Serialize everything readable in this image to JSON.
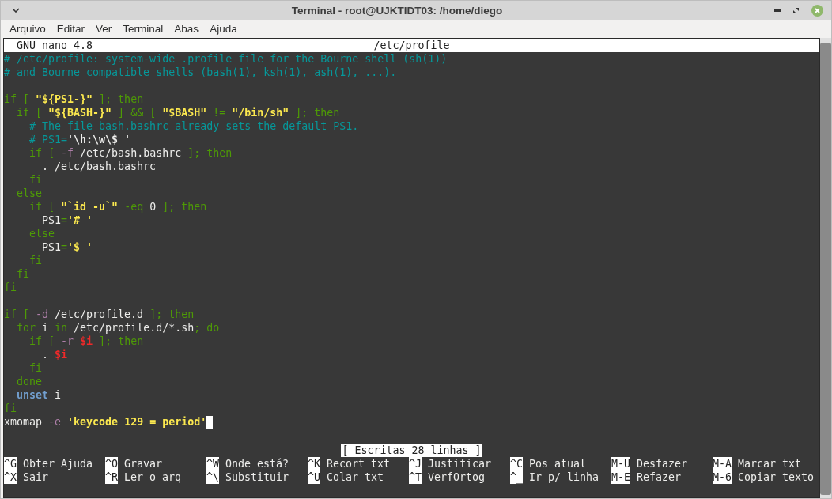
{
  "window": {
    "title": "Terminal - root@UJKTIDT03: /home/diego"
  },
  "menu": [
    "Arquivo",
    "Editar",
    "Ver",
    "Terminal",
    "Abas",
    "Ajuda"
  ],
  "nano": {
    "version": "GNU nano 4.8",
    "filename": "/etc/profile"
  },
  "lines": [
    {
      "cursor": false,
      "segments": [
        {
          "kind": "comment",
          "text": "# /etc/profile: system-wide .profile file for the Bourne shell (sh(1))"
        }
      ]
    },
    {
      "cursor": false,
      "segments": [
        {
          "kind": "comment",
          "text": "# and Bourne compatible shells (bash(1), ksh(1), ash(1), ...)."
        }
      ]
    },
    {
      "cursor": false
    },
    {
      "cursor": false,
      "segments": [
        {
          "kind": "keyword",
          "text": "if [ "
        },
        {
          "kind": "string",
          "text": "\"${PS1-}\""
        },
        {
          "kind": "keyword",
          "text": " ]; then"
        }
      ]
    },
    {
      "cursor": false,
      "segments": [
        {
          "kind": "keyword",
          "text": "  if [ "
        },
        {
          "kind": "string",
          "text": "\"${BASH-}\""
        },
        {
          "kind": "keyword",
          "text": " ] && [ "
        },
        {
          "kind": "string",
          "text": "\"$BASH\""
        },
        {
          "kind": "keyword",
          "text": " != "
        },
        {
          "kind": "string",
          "text": "\"/bin/sh\""
        },
        {
          "kind": "keyword",
          "text": " ]; then"
        }
      ]
    },
    {
      "cursor": false,
      "segments": [
        {
          "kind": "comment",
          "text": "    # The file bash.bashrc already sets the default PS1."
        }
      ]
    },
    {
      "cursor": false,
      "segments": [
        {
          "kind": "comment",
          "text": "    # PS1="
        },
        {
          "kind": "quoted",
          "text": "'\\h:\\w\\$ '"
        }
      ]
    },
    {
      "cursor": false,
      "segments": [
        {
          "kind": "keyword",
          "text": "    if [ "
        },
        {
          "kind": "option",
          "text": "-f"
        },
        {
          "kind": "plain",
          "text": " /etc/bash.bashrc "
        },
        {
          "kind": "keyword",
          "text": "]; then"
        }
      ]
    },
    {
      "cursor": false,
      "segments": [
        {
          "kind": "plain",
          "text": "      . /etc/bash.bashrc"
        }
      ]
    },
    {
      "cursor": false,
      "segments": [
        {
          "kind": "keyword",
          "text": "    fi"
        }
      ]
    },
    {
      "cursor": false,
      "segments": [
        {
          "kind": "keyword",
          "text": "  else"
        }
      ]
    },
    {
      "cursor": false,
      "segments": [
        {
          "kind": "keyword",
          "text": "    if [ "
        },
        {
          "kind": "string",
          "text": "\"`id -u`\""
        },
        {
          "kind": "keyword",
          "text": " -eq "
        },
        {
          "kind": "plain",
          "text": "0"
        },
        {
          "kind": "keyword",
          "text": " ]; then"
        }
      ]
    },
    {
      "cursor": false,
      "segments": [
        {
          "kind": "plain",
          "text": "      PS1"
        },
        {
          "kind": "keyword",
          "text": "="
        },
        {
          "kind": "string",
          "text": "'# '"
        }
      ]
    },
    {
      "cursor": false,
      "segments": [
        {
          "kind": "keyword",
          "text": "    else"
        }
      ]
    },
    {
      "cursor": false,
      "segments": [
        {
          "kind": "plain",
          "text": "      PS1"
        },
        {
          "kind": "keyword",
          "text": "="
        },
        {
          "kind": "string",
          "text": "'$ '"
        }
      ]
    },
    {
      "cursor": false,
      "segments": [
        {
          "kind": "keyword",
          "text": "    fi"
        }
      ]
    },
    {
      "cursor": false,
      "segments": [
        {
          "kind": "keyword",
          "text": "  fi"
        }
      ]
    },
    {
      "cursor": false,
      "segments": [
        {
          "kind": "keyword",
          "text": "fi"
        }
      ]
    },
    {
      "cursor": false
    },
    {
      "cursor": false,
      "segments": [
        {
          "kind": "keyword",
          "text": "if [ "
        },
        {
          "kind": "option",
          "text": "-d"
        },
        {
          "kind": "plain",
          "text": " /etc/profile.d "
        },
        {
          "kind": "keyword",
          "text": "]; then"
        }
      ]
    },
    {
      "cursor": false,
      "segments": [
        {
          "kind": "keyword",
          "text": "  for "
        },
        {
          "kind": "plain",
          "text": "i "
        },
        {
          "kind": "keyword",
          "text": "in"
        },
        {
          "kind": "plain",
          "text": " /etc/profile.d/*.sh"
        },
        {
          "kind": "keyword",
          "text": "; do"
        }
      ]
    },
    {
      "cursor": false,
      "segments": [
        {
          "kind": "keyword",
          "text": "    if [ "
        },
        {
          "kind": "option",
          "text": "-r "
        },
        {
          "kind": "variable",
          "text": "$i"
        },
        {
          "kind": "keyword",
          "text": " ]; then"
        }
      ]
    },
    {
      "cursor": false,
      "segments": [
        {
          "kind": "plain",
          "text": "      . "
        },
        {
          "kind": "variable",
          "text": "$i"
        }
      ]
    },
    {
      "cursor": false,
      "segments": [
        {
          "kind": "keyword",
          "text": "    fi"
        }
      ]
    },
    {
      "cursor": false,
      "segments": [
        {
          "kind": "keyword",
          "text": "  done"
        }
      ]
    },
    {
      "cursor": false,
      "segments": [
        {
          "kind": "builtin",
          "text": "  unset"
        },
        {
          "kind": "plain",
          "text": " i"
        }
      ]
    },
    {
      "cursor": false,
      "segments": [
        {
          "kind": "keyword",
          "text": "fi"
        }
      ]
    },
    {
      "cursor": true,
      "segments": [
        {
          "kind": "plain",
          "text": "xmomap "
        },
        {
          "kind": "option",
          "text": "-e "
        },
        {
          "kind": "string",
          "text": "'keycode 129 = period'"
        }
      ]
    }
  ],
  "status": "[ Escritas 28 linhas ]",
  "shortcut_rows": [
    [
      {
        "key": "^G",
        "label": "Obter Ajuda"
      },
      {
        "key": "^O",
        "label": "Gravar"
      },
      {
        "key": "^W",
        "label": "Onde está?"
      },
      {
        "key": "^K",
        "label": "Recort txt"
      },
      {
        "key": "^J",
        "label": "Justificar"
      },
      {
        "key": "^C",
        "label": "Pos atual"
      },
      {
        "key": "M-U",
        "label": "Desfazer"
      },
      {
        "key": "M-A",
        "label": "Marcar txt"
      }
    ],
    [
      {
        "key": "^X",
        "label": "Sair"
      },
      {
        "key": "^R",
        "label": "Ler o arq"
      },
      {
        "key": "^\\",
        "label": "Substituir"
      },
      {
        "key": "^U",
        "label": "Colar txt"
      },
      {
        "key": "^T",
        "label": "VerfOrtog"
      },
      {
        "key": "^_",
        "label": "Ir p/ linha"
      },
      {
        "key": "M-E",
        "label": "Refazer"
      },
      {
        "key": "M-6",
        "label": "Copiar texto"
      }
    ]
  ]
}
